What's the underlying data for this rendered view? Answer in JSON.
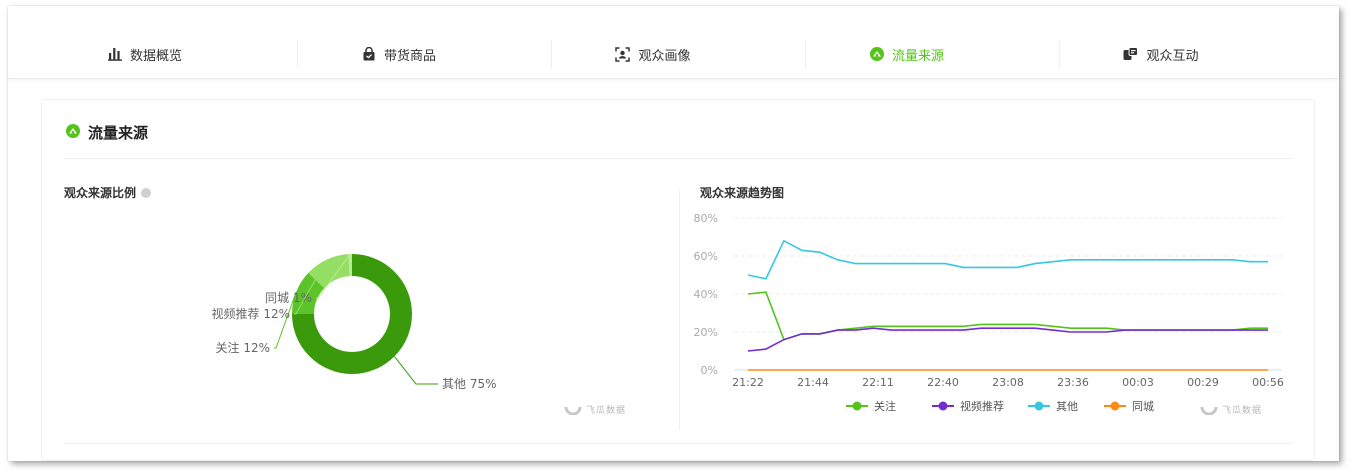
{
  "tabs": [
    {
      "label": "数据概览",
      "icon": "bar-chart-icon",
      "active": false
    },
    {
      "label": "带货商品",
      "icon": "shopping-bag-icon",
      "active": false
    },
    {
      "label": "观众画像",
      "icon": "face-scan-icon",
      "active": false
    },
    {
      "label": "流量来源",
      "icon": "source-icon",
      "active": true
    },
    {
      "label": "观众互动",
      "icon": "interaction-icon",
      "active": false
    }
  ],
  "section": {
    "title": "流量来源"
  },
  "pie_panel": {
    "title": "观众来源比例"
  },
  "line_panel": {
    "title": "观众来源趋势图"
  },
  "watermark": {
    "text": "飞瓜数据",
    "sub": "F E I G U A . C N"
  },
  "colors": {
    "accent": "#52c41a",
    "guanzhu": "#52c41a",
    "shipin": "#722ed1",
    "qita": "#36c8e0",
    "tongcheng": "#fa8c16"
  },
  "chart_data": [
    {
      "type": "pie",
      "variant": "donut",
      "title": "观众来源比例",
      "slices": [
        {
          "label": "其他",
          "value": 75,
          "text": "其他 75%",
          "color": "#3a9a0c"
        },
        {
          "label": "关注",
          "value": 12,
          "text": "关注 12%",
          "color": "#5cc32a"
        },
        {
          "label": "视频推荐",
          "value": 12,
          "text": "视频推荐 12%",
          "color": "#95de64"
        },
        {
          "label": "同城",
          "value": 1,
          "text": "同城 1%",
          "color": "#b7eb8f"
        }
      ]
    },
    {
      "type": "line",
      "title": "观众来源趋势图",
      "xlabel": "",
      "ylabel": "",
      "x_ticks": [
        "21:22",
        "21:44",
        "22:11",
        "22:40",
        "23:08",
        "23:36",
        "00:03",
        "00:29",
        "00:56"
      ],
      "y_ticks": [
        "0%",
        "20%",
        "40%",
        "60%",
        "80%"
      ],
      "ylim": [
        0,
        80
      ],
      "grid": true,
      "legend_position": "bottom",
      "series": [
        {
          "name": "关注",
          "color": "#52c41a",
          "values": [
            40,
            41,
            16,
            19,
            19,
            21,
            22,
            23,
            23,
            23,
            23,
            23,
            23,
            24,
            24,
            24,
            24,
            23,
            22,
            22,
            22,
            21,
            21,
            21,
            21,
            21,
            21,
            21,
            22,
            22
          ]
        },
        {
          "name": "视频推荐",
          "color": "#722ed1",
          "values": [
            10,
            11,
            16,
            19,
            19,
            21,
            21,
            22,
            21,
            21,
            21,
            21,
            21,
            22,
            22,
            22,
            22,
            21,
            20,
            20,
            20,
            21,
            21,
            21,
            21,
            21,
            21,
            21,
            21,
            21
          ]
        },
        {
          "name": "其他",
          "color": "#36c8e0",
          "values": [
            50,
            48,
            68,
            63,
            62,
            58,
            56,
            56,
            56,
            56,
            56,
            56,
            54,
            54,
            54,
            54,
            56,
            57,
            58,
            58,
            58,
            58,
            58,
            58,
            58,
            58,
            58,
            58,
            57,
            57
          ]
        },
        {
          "name": "同城",
          "color": "#fa8c16",
          "values": [
            0,
            0,
            0,
            0,
            0,
            0,
            0,
            0,
            0,
            0,
            0,
            0,
            0,
            0,
            0,
            0,
            0,
            0,
            0,
            0,
            0,
            0,
            0,
            0,
            0,
            0,
            0,
            0,
            0,
            0
          ]
        }
      ]
    }
  ]
}
